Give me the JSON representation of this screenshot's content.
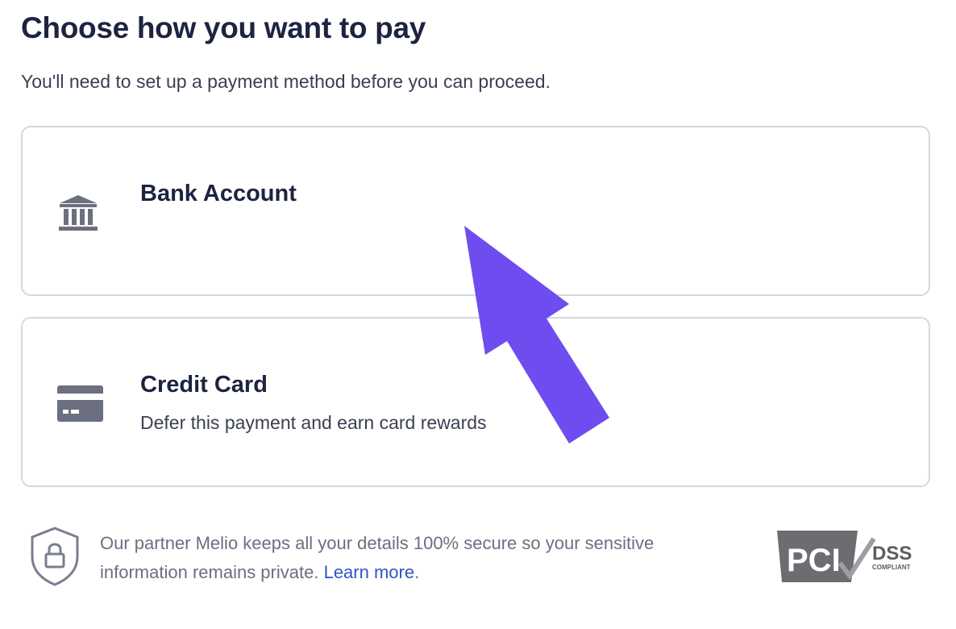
{
  "page": {
    "title": "Choose how you want to pay",
    "subtitle": "You'll need to set up a payment method before you can proceed."
  },
  "options": [
    {
      "title": "Bank Account",
      "description": "",
      "icon": "bank-icon"
    },
    {
      "title": "Credit Card",
      "description": "Defer this payment and earn card rewards",
      "icon": "credit-card-icon"
    }
  ],
  "security": {
    "text": "Our partner Melio keeps all your details 100% secure so your sensitive information remains private.",
    "link_label": "Learn more",
    "suffix": ".",
    "icon": "shield-lock-icon"
  },
  "badge": {
    "label": "PCI",
    "dss": "DSS",
    "compliant": "COMPLIANT"
  },
  "colors": {
    "heading": "#1d2340",
    "arrow": "#6e4cf0",
    "link": "#2f55c7",
    "border": "#d6d8de"
  }
}
